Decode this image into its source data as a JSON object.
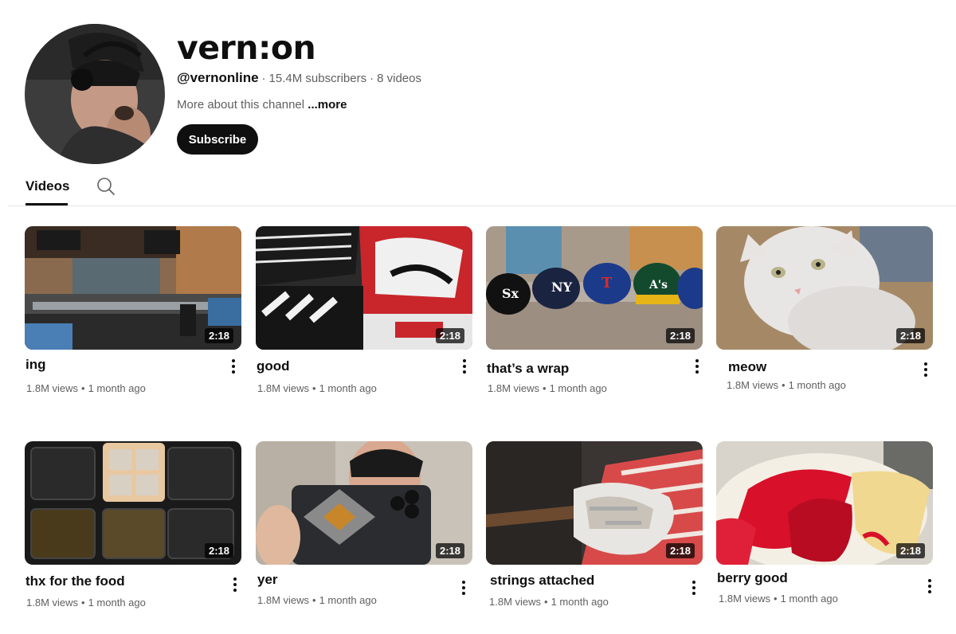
{
  "channel": {
    "name": "vern:on",
    "handle": "@vernonline",
    "subscribers": "15.4M subscribers",
    "videos_count": "8 videos",
    "about": "More about this channel",
    "more": "...more",
    "subscribe_label": "Subscribe"
  },
  "tabs": {
    "videos_label": "Videos"
  },
  "icons": {
    "search_tab": "search-icon",
    "menu": "more-vert-icon"
  },
  "videos": [
    {
      "title": "ing",
      "duration": "2:18",
      "views": "1.8M views",
      "age": "1 month ago"
    },
    {
      "title": "good",
      "duration": "2:18",
      "views": "1.8M views",
      "age": "1 month ago"
    },
    {
      "title": "that’s a wrap",
      "duration": "2:18",
      "views": "1.8M views",
      "age": "1 month ago"
    },
    {
      "title": "meow",
      "duration": "2:18",
      "views": "1.8M views",
      "age": "1 month ago"
    },
    {
      "title": "thx for the food",
      "duration": "2:18",
      "views": "1.8M views",
      "age": "1 month ago"
    },
    {
      "title": "yer",
      "duration": "2:18",
      "views": "1.8M views",
      "age": "1 month ago"
    },
    {
      "title": "strings attached",
      "duration": "2:18",
      "views": "1.8M views",
      "age": "1 month ago"
    },
    {
      "title": "berry good",
      "duration": "2:18",
      "views": "1.8M views",
      "age": "1 month ago"
    }
  ]
}
